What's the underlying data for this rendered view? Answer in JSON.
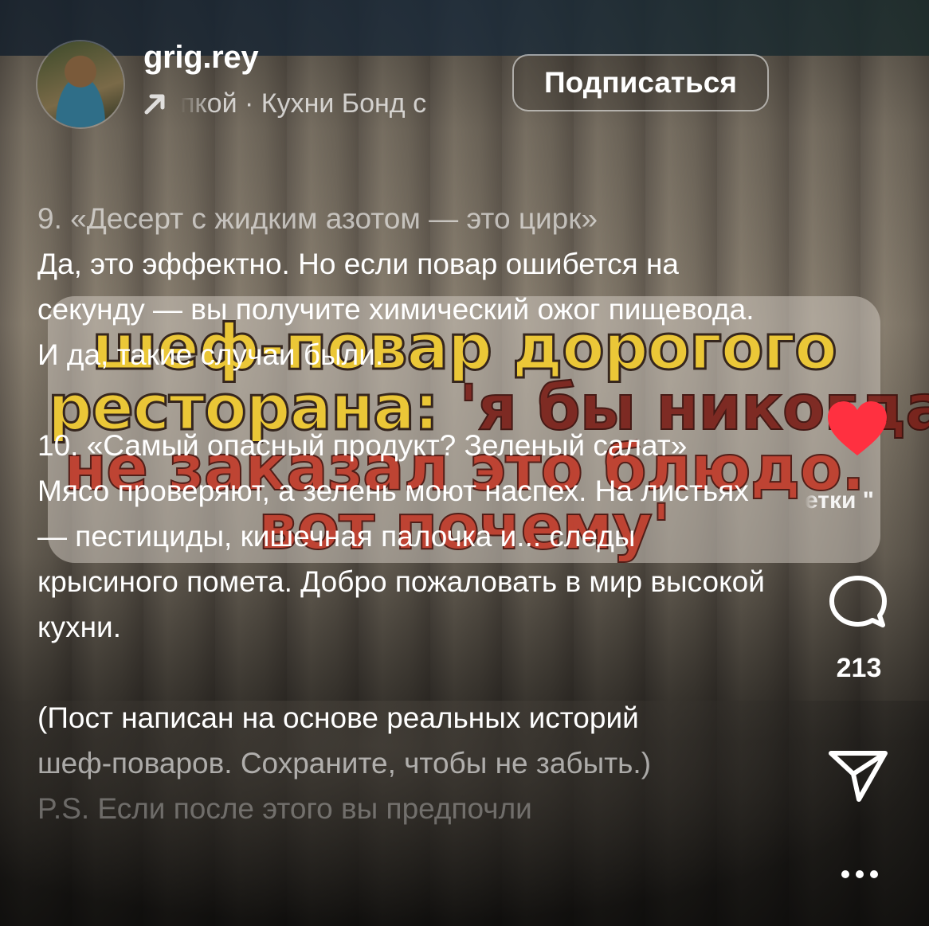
{
  "header": {
    "username": "grig.rey",
    "music_text": "пкой · Кухни    Бонд с",
    "subscribe_label": "Подписаться"
  },
  "video_overlay": {
    "line1": "шеф-повар дорогого",
    "line2_a": "ресторана:",
    "line2_b": " 'я бы никогда",
    "line3": "не заказал это блюдо.",
    "line4": "вот почему'"
  },
  "caption": {
    "item9_title": "9. «Десерт с жидким азотом — это цирк»",
    "item9_body": "Да, это эффектно. Но если повар ошибется на секунду — вы получите химический ожог пищевода. И да, такие случаи были.",
    "item10_title": "10. «Самый опасный продукт? Зеленый салат»",
    "item10_body": "Мясо проверяют, а зелень моют наспех. На листьях — пестициды, кишечная палочка и... следы крысиного помета. Добро пожаловать в мир высокой кухни.",
    "note_line1": "(Пост написан на основе реальных историй",
    "note_line2": "шеф-поваров. Сохраните, чтобы не забыть.)",
    "ps_line": "P.S. Если после этого вы предпочли"
  },
  "rail": {
    "side_label": "етки \"",
    "comment_count": "213"
  },
  "colors": {
    "like": "#ff3040",
    "text": "#ffffff"
  },
  "icons": [
    "music-arrow-icon",
    "heart-icon",
    "comment-icon",
    "share-icon",
    "more-icon"
  ]
}
